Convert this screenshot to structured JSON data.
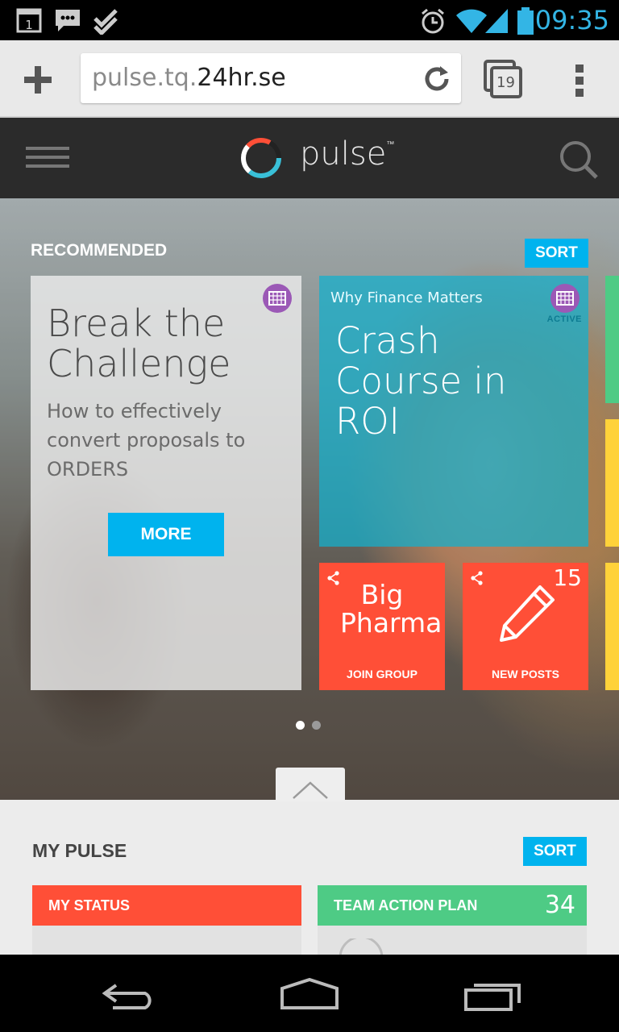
{
  "statusbar": {
    "time": "09:35",
    "icons": [
      "calendar-notification-icon",
      "message-notification-icon",
      "task-done-icon",
      "alarm-icon",
      "wifi-icon",
      "signal-icon",
      "battery-icon"
    ],
    "calendar_day": "1",
    "accent": "#33b5e5"
  },
  "browser": {
    "url_prefix": "pulse.tq.",
    "url_domain": "24hr.se",
    "tab_count": "19"
  },
  "app": {
    "brand": "pulse",
    "tm": "™"
  },
  "hero": {
    "section_label": "RECOMMENDED",
    "sort_label": "SORT",
    "card_break": {
      "title": "Break the Challenge",
      "description": "How to effectively convert proposals to ORDERS",
      "button": "MORE"
    },
    "card_crash": {
      "kicker": "Why Finance Matters",
      "title": "Crash Course in ROI",
      "status": "ACTIVE"
    },
    "tile_group": {
      "title": "Big Pharma",
      "action": "JOIN GROUP"
    },
    "tile_posts": {
      "count": "15",
      "action": "NEW POSTS"
    },
    "page_indicator": {
      "current": 1,
      "total": 2
    }
  },
  "my_pulse": {
    "label": "MY PULSE",
    "sort_label": "SORT",
    "panels": [
      {
        "title": "MY STATUS",
        "count": "",
        "color": "#ff4f37"
      },
      {
        "title": "TEAM ACTION PLAN",
        "count": "34",
        "color": "#4ecb85"
      }
    ]
  },
  "colors": {
    "accent_blue": "#00b3ee",
    "tile_red": "#ff4f37",
    "green": "#4ecb85",
    "yellow": "#ffd23a",
    "purple": "#9b59b6"
  }
}
